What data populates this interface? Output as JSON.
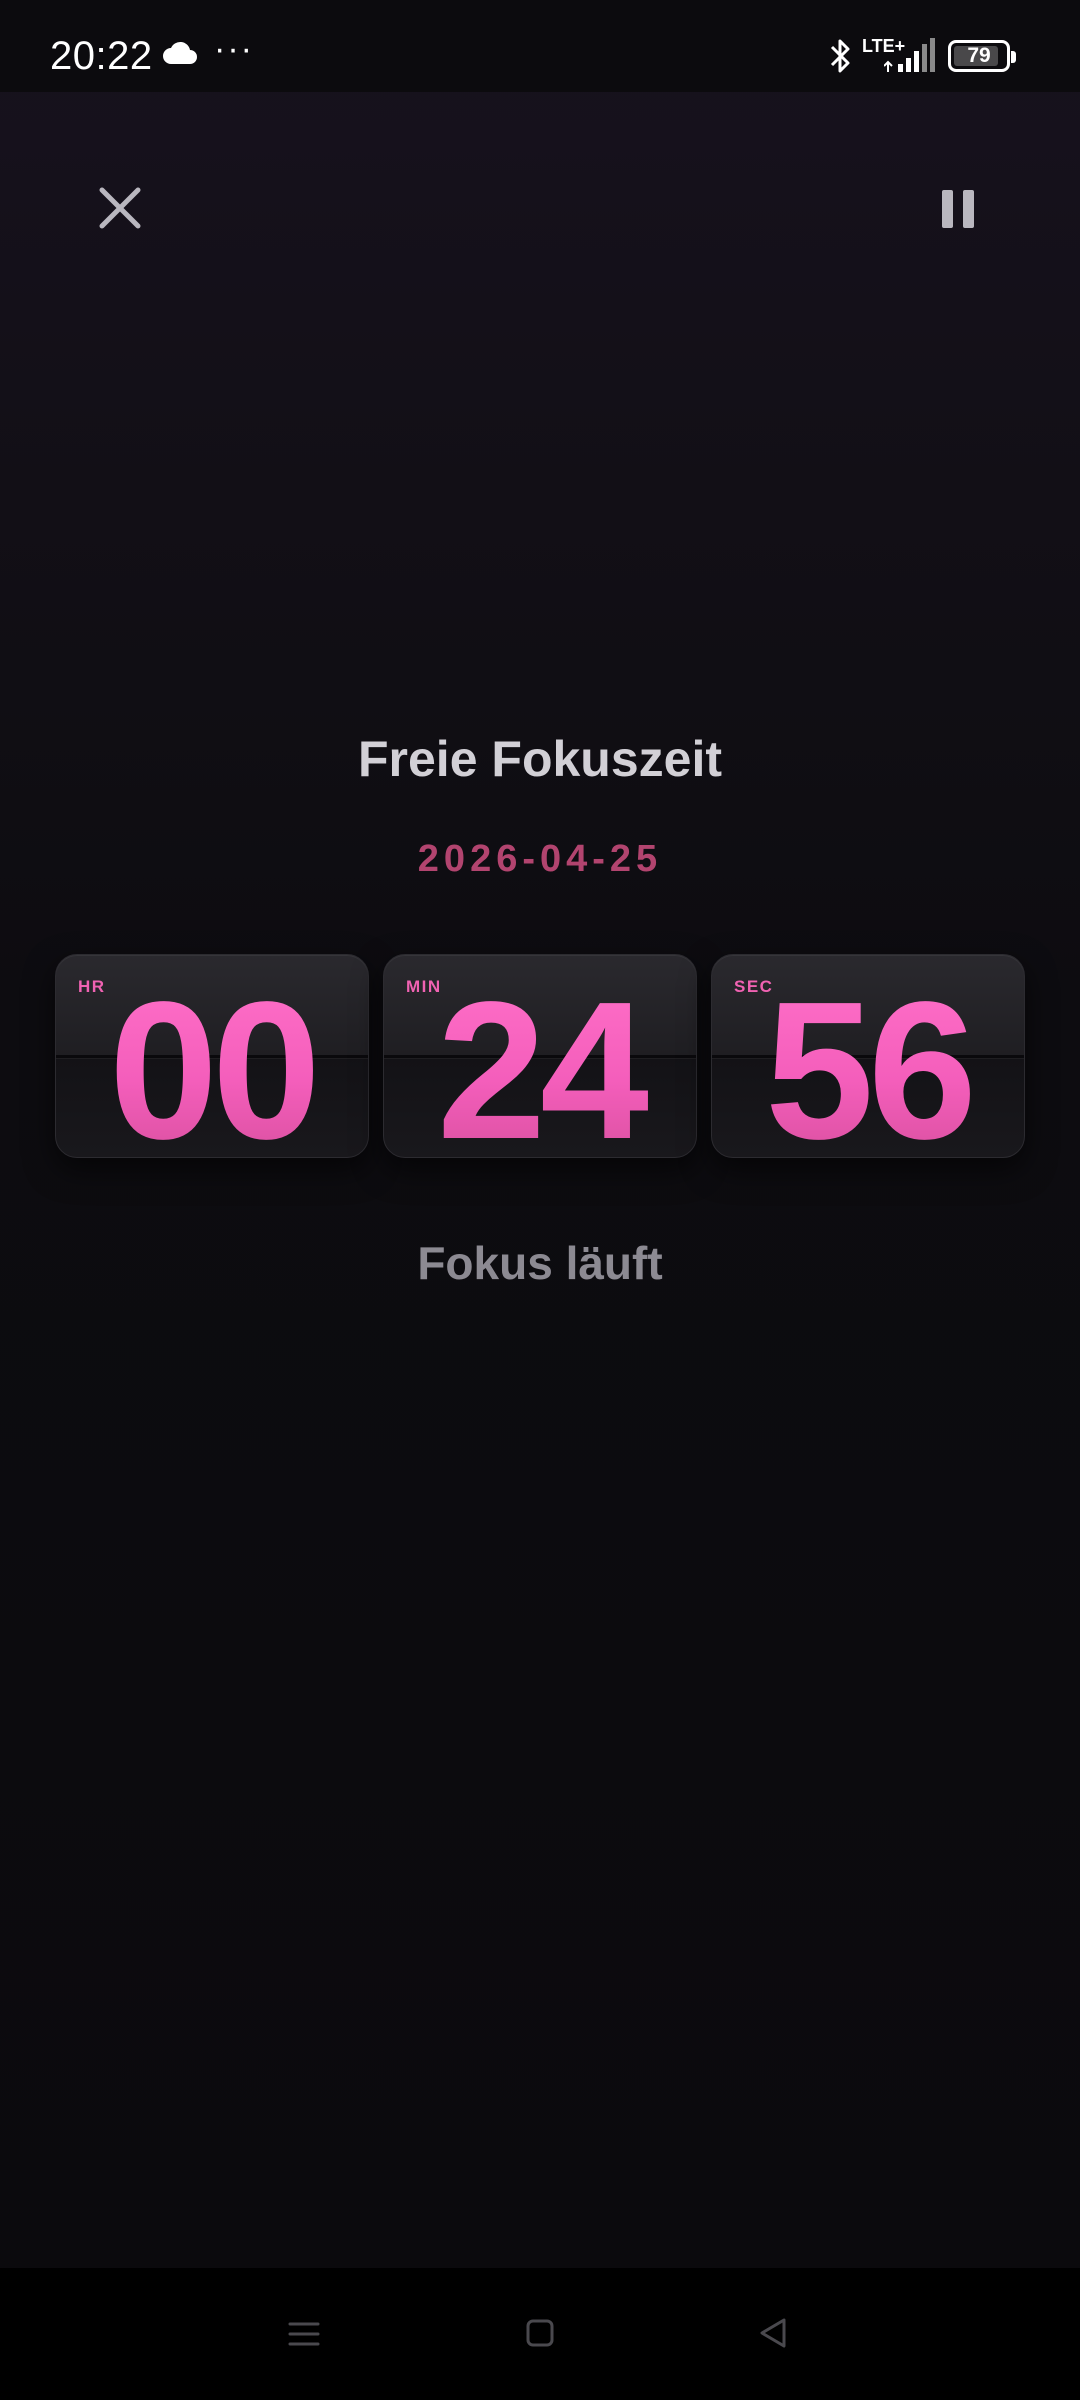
{
  "status_bar": {
    "time": "20:22",
    "dots": "···",
    "network": "LTE+",
    "battery": "79",
    "icons": [
      "cloud-icon",
      "bluetooth-icon",
      "signal-icon",
      "battery-icon"
    ]
  },
  "header": {
    "close_icon": "close-icon",
    "pause_icon": "pause-icon"
  },
  "session": {
    "title": "Freie Fokuszeit",
    "date": "2026-04-25",
    "status": "Fokus läuft"
  },
  "timer": {
    "hours": {
      "label": "HR",
      "value": "00"
    },
    "minutes": {
      "label": "MIN",
      "value": "24"
    },
    "seconds": {
      "label": "SEC",
      "value": "56"
    }
  },
  "colors": {
    "accent": "#f25fb8",
    "date": "#b2446f",
    "background": "#0b0a0d",
    "card": "#1f1e22"
  },
  "navigation": {
    "icons": [
      "menu-icon",
      "home-icon",
      "back-icon"
    ]
  }
}
